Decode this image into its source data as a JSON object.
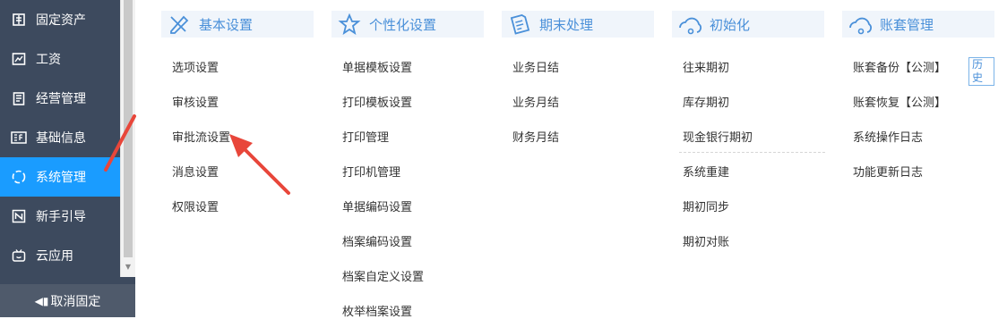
{
  "sidebar": {
    "items": [
      {
        "label": "固定资产",
        "icon": "fixed-assets-icon"
      },
      {
        "label": "工资",
        "icon": "salary-icon"
      },
      {
        "label": "经营管理",
        "icon": "business-management-icon"
      },
      {
        "label": "基础信息",
        "icon": "basic-info-icon"
      },
      {
        "label": "系统管理",
        "icon": "system-management-icon",
        "active": true
      },
      {
        "label": "新手引导",
        "icon": "beginner-guide-icon"
      },
      {
        "label": "云应用",
        "icon": "cloud-app-icon"
      }
    ],
    "footer_label": "取消固定"
  },
  "columns": [
    {
      "title": "基本设置",
      "icon": "basic-settings-icon",
      "items": [
        "选项设置",
        "审核设置",
        "审批流设置",
        "消息设置",
        "权限设置"
      ]
    },
    {
      "title": "个性化设置",
      "icon": "personalization-icon",
      "items": [
        "单据模板设置",
        "打印模板设置",
        "打印管理",
        "打印机管理",
        "单据编码设置",
        "档案编码设置",
        "档案自定义设置",
        "枚举档案设置"
      ]
    },
    {
      "title": "期末处理",
      "icon": "period-end-icon",
      "items": [
        "业务日结",
        "业务月结",
        "财务月结"
      ]
    },
    {
      "title": "初始化",
      "icon": "initialization-icon",
      "items": [
        "往来期初",
        "库存期初",
        "现金银行期初",
        "系统重建",
        "期初同步",
        "期初对账"
      ]
    },
    {
      "title": "账套管理",
      "icon": "account-set-icon",
      "items": [
        "账套备份【公测】",
        "账套恢复【公测】",
        "系统操作日志",
        "功能更新日志"
      ],
      "badge": "历史"
    }
  ],
  "colors": {
    "sidebar_bg": "#3d4a5e",
    "active_bg": "#1a9cff",
    "accent": "#4a90d9",
    "arrow": "#e8463a"
  }
}
